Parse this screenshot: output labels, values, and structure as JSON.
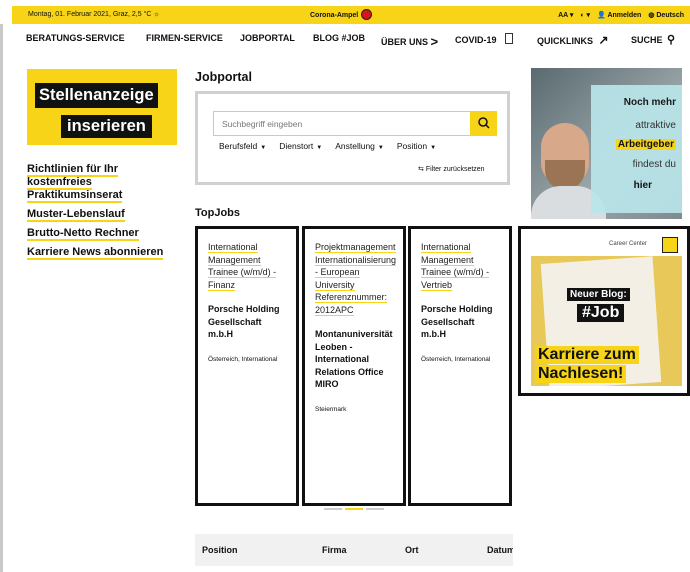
{
  "topbar": {
    "date": "Montag, 01. Februar 2021, Graz, 2,5 °C ☼",
    "corona": "Corona-Ampel",
    "font_size": "AA ▾",
    "contrast": "◐ ▾",
    "login": "Anmelden",
    "language": "Deutsch"
  },
  "nav": {
    "items": [
      "BERATUNGS-SERVICE",
      "FIRMEN-SERVICE",
      "JOBPORTAL",
      "BLOG #JOB",
      "ÜBER UNS",
      "COVID-19",
      "QUICKLINKS",
      "SUCHE"
    ]
  },
  "sidebar": {
    "stellen_line1": "Stellenanzeige",
    "stellen_line2": "inserieren",
    "links": [
      "Richtlinien für Ihr kostenfreies Praktikumsinserat",
      "Muster-Lebenslauf",
      "Brutto-Netto Rechner",
      "Karriere News abonnieren"
    ]
  },
  "jobportal": {
    "title": "Jobportal",
    "search_placeholder": "Suchbegriff eingeben",
    "filters": [
      "Berufsfeld",
      "Dienstort",
      "Anstellung",
      "Position"
    ],
    "reset": "Filter zurücksetzen"
  },
  "topjobs": {
    "title": "TopJobs",
    "cards": [
      {
        "title": "International Management Trainee (w/m/d) - Finanz",
        "company": "Porsche Holding Gesellschaft m.b.H",
        "location": "Österreich, International"
      },
      {
        "title": "Projektmanagement Internationalisierung - European University Referenznummer: 2012APC",
        "company": "Montanuniversität Leoben - International Relations Office MIRO",
        "location": "Steiermark"
      },
      {
        "title": "International Management Trainee (w/m/d) - Vertrieb",
        "company": "Porsche Holding Gesellschaft m.b.H",
        "location": "Österreich, International"
      }
    ]
  },
  "table": {
    "headers": [
      "Position",
      "Firma",
      "Ort",
      "Datum"
    ]
  },
  "ad1": {
    "lines": [
      "Noch mehr",
      "attraktive",
      "Arbeitgeber",
      "findest du",
      "hier"
    ]
  },
  "ad2": {
    "logo": "Career Center",
    "line1": "Neuer Blog:",
    "line2": "#Job",
    "line3": "Karriere zum",
    "line4": "Nachlesen!"
  },
  "colors": {
    "accent": "#f7d417",
    "dark": "#111111"
  }
}
